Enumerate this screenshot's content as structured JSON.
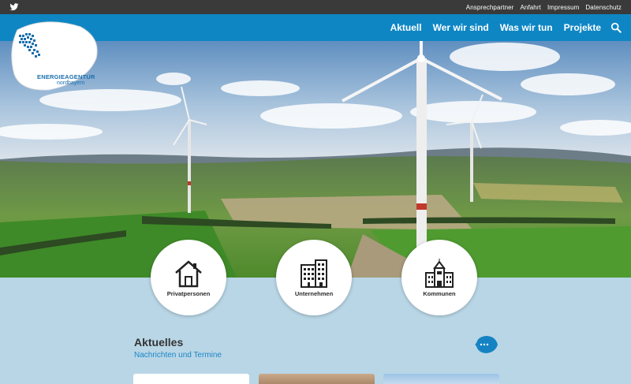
{
  "topbar": {
    "links": [
      "Ansprechpartner",
      "Anfahrt",
      "Impressum",
      "Datenschutz"
    ]
  },
  "nav": {
    "items": [
      "Aktuell",
      "Wer wir sind",
      "Was wir tun",
      "Projekte"
    ]
  },
  "logo": {
    "line1": "ENERGIEAGENTUR",
    "line2": "nordbayern"
  },
  "categories": [
    {
      "label": "Privatpersonen",
      "icon": "house-icon"
    },
    {
      "label": "Unternehmen",
      "icon": "office-building-icon"
    },
    {
      "label": "Kommunen",
      "icon": "town-hall-icon"
    }
  ],
  "news": {
    "title": "Aktuelles",
    "subtitle": "Nachrichten und Termine",
    "more_label": "..."
  },
  "colors": {
    "topbar": "#3a3a3a",
    "nav": "#0e86c4",
    "background": "#b9d6e6",
    "accent": "#1a86c7"
  }
}
